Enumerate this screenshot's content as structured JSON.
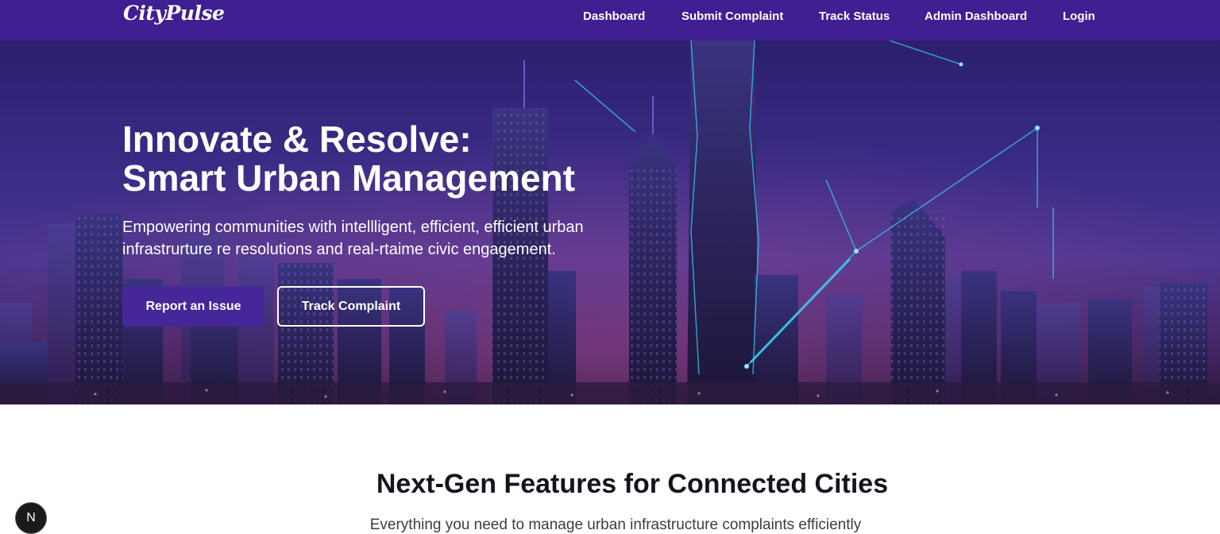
{
  "brand": {
    "name": "CityPulse"
  },
  "nav": {
    "items": [
      {
        "label": "Dashboard"
      },
      {
        "label": "Submit Complaint"
      },
      {
        "label": "Track Status"
      },
      {
        "label": "Admin Dashboard"
      },
      {
        "label": "Login"
      }
    ]
  },
  "hero": {
    "title_line1": "Innovate & Resolve:",
    "title_line2": "Smart Urban Management",
    "subtitle": "Empowering communities with intellligent, efficient, efficient urban infrastrurture re resolutions and real-rtaime civic engagement.",
    "primary_button": "Report an Issue",
    "secondary_button": "Track Complaint"
  },
  "features": {
    "title": "Next-Gen Features for Connected Cities",
    "subtitle": "Everything you need to manage urban infrastructure complaints efficiently"
  },
  "dev_badge": {
    "label": "N"
  },
  "colors": {
    "navbar": "#3f1f92",
    "primary_button": "#45279a",
    "hero_glow": "#38c8f0"
  }
}
